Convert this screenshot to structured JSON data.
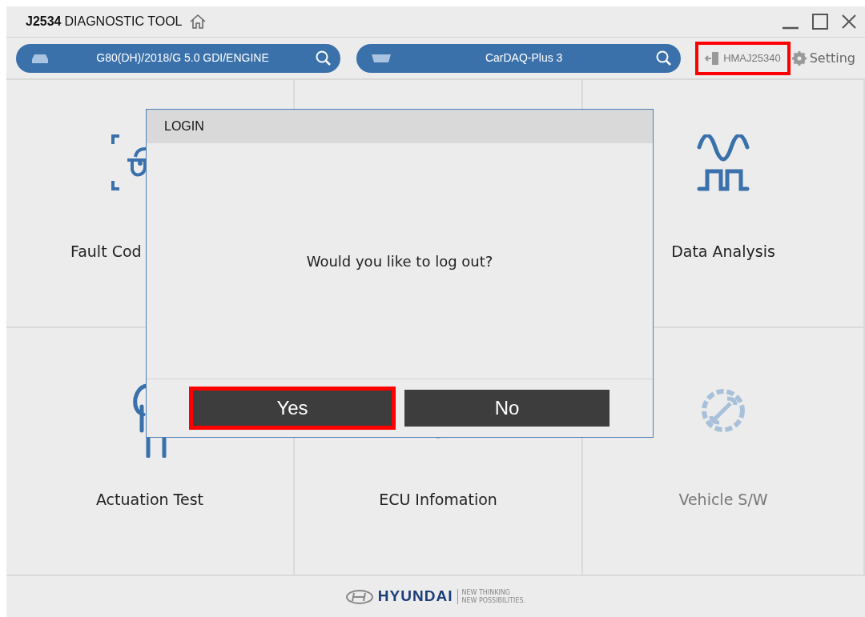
{
  "window": {
    "title_bold": "J2534",
    "title": "DIAGNOSTIC TOOL"
  },
  "toolbar": {
    "vehicle": {
      "value": "G80(DH)/2018/G 5.0 GDI/ENGINE"
    },
    "device": {
      "value": "CarDAQ-Plus 3"
    },
    "user": {
      "label": "HMAJ25340",
      "highlighted": true
    },
    "setting": {
      "label": "Setting"
    }
  },
  "tiles": [
    {
      "kind": "fault",
      "label": "Fault Cod",
      "disabled": false
    },
    {
      "kind": "hidden"
    },
    {
      "kind": "data",
      "label": "Data Analysis",
      "disabled": false
    },
    {
      "kind": "actuation",
      "label": "Actuation Test",
      "disabled": false
    },
    {
      "kind": "ecu",
      "label": "ECU Infomation",
      "disabled": false
    },
    {
      "kind": "vehicle",
      "label": "Vehicle S/W",
      "disabled": true
    }
  ],
  "dialog": {
    "title": "LOGIN",
    "message": "Would you like to log out?",
    "buttons": [
      {
        "label": "Yes",
        "highlighted": true
      },
      {
        "label": "No",
        "highlighted": false
      }
    ]
  },
  "footer": {
    "brand": "HYUNDAI",
    "tagline_1": "NEW THINKING",
    "tagline_2": "NEW POSSIBILITIES."
  }
}
